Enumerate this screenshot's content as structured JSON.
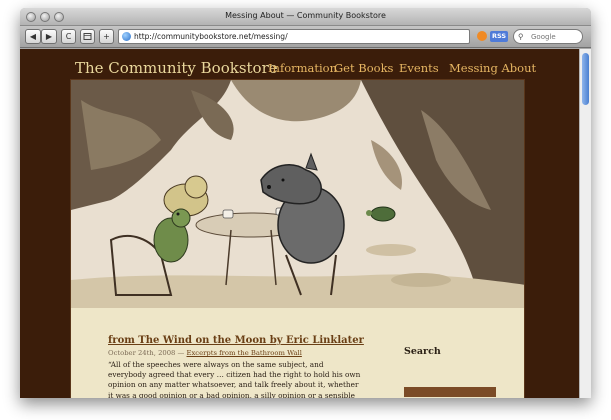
{
  "window": {
    "title": "Messing About — Community Bookstore"
  },
  "toolbar": {
    "back_glyph": "◀",
    "forward_glyph": "▶",
    "reload_glyph": "C",
    "add_glyph": "+",
    "url": "http://communitybookstore.net/messing/",
    "rss_label": "RSS",
    "search_placeholder": "Google"
  },
  "site": {
    "title": "The Community Bookstore",
    "nav": [
      "Information",
      "Get Books",
      "Events",
      "Messing About"
    ]
  },
  "post": {
    "title": "from The Wind on the Moon by Eric Linklater",
    "date": "October 24th, 2008",
    "separator": "—",
    "category": "Excerpts from the Bathroom Wall",
    "body": "“All of the speeches were always on the same subject, and everybody agreed that every … citizen had the right to hold his own opinion on any matter whatsoever, and talk freely about it, whether it was a good opinion or a bad opinion, a silly opinion or a sensible opinion, or an opinion he had formed […]"
  },
  "sidebar": {
    "search_title": "Search"
  },
  "colors": {
    "page_background": "#3b1d0a",
    "content_background": "#eee6c8",
    "site_title": "#e9d79c",
    "nav_link": "#e6b663",
    "post_link": "#6a3f15"
  }
}
